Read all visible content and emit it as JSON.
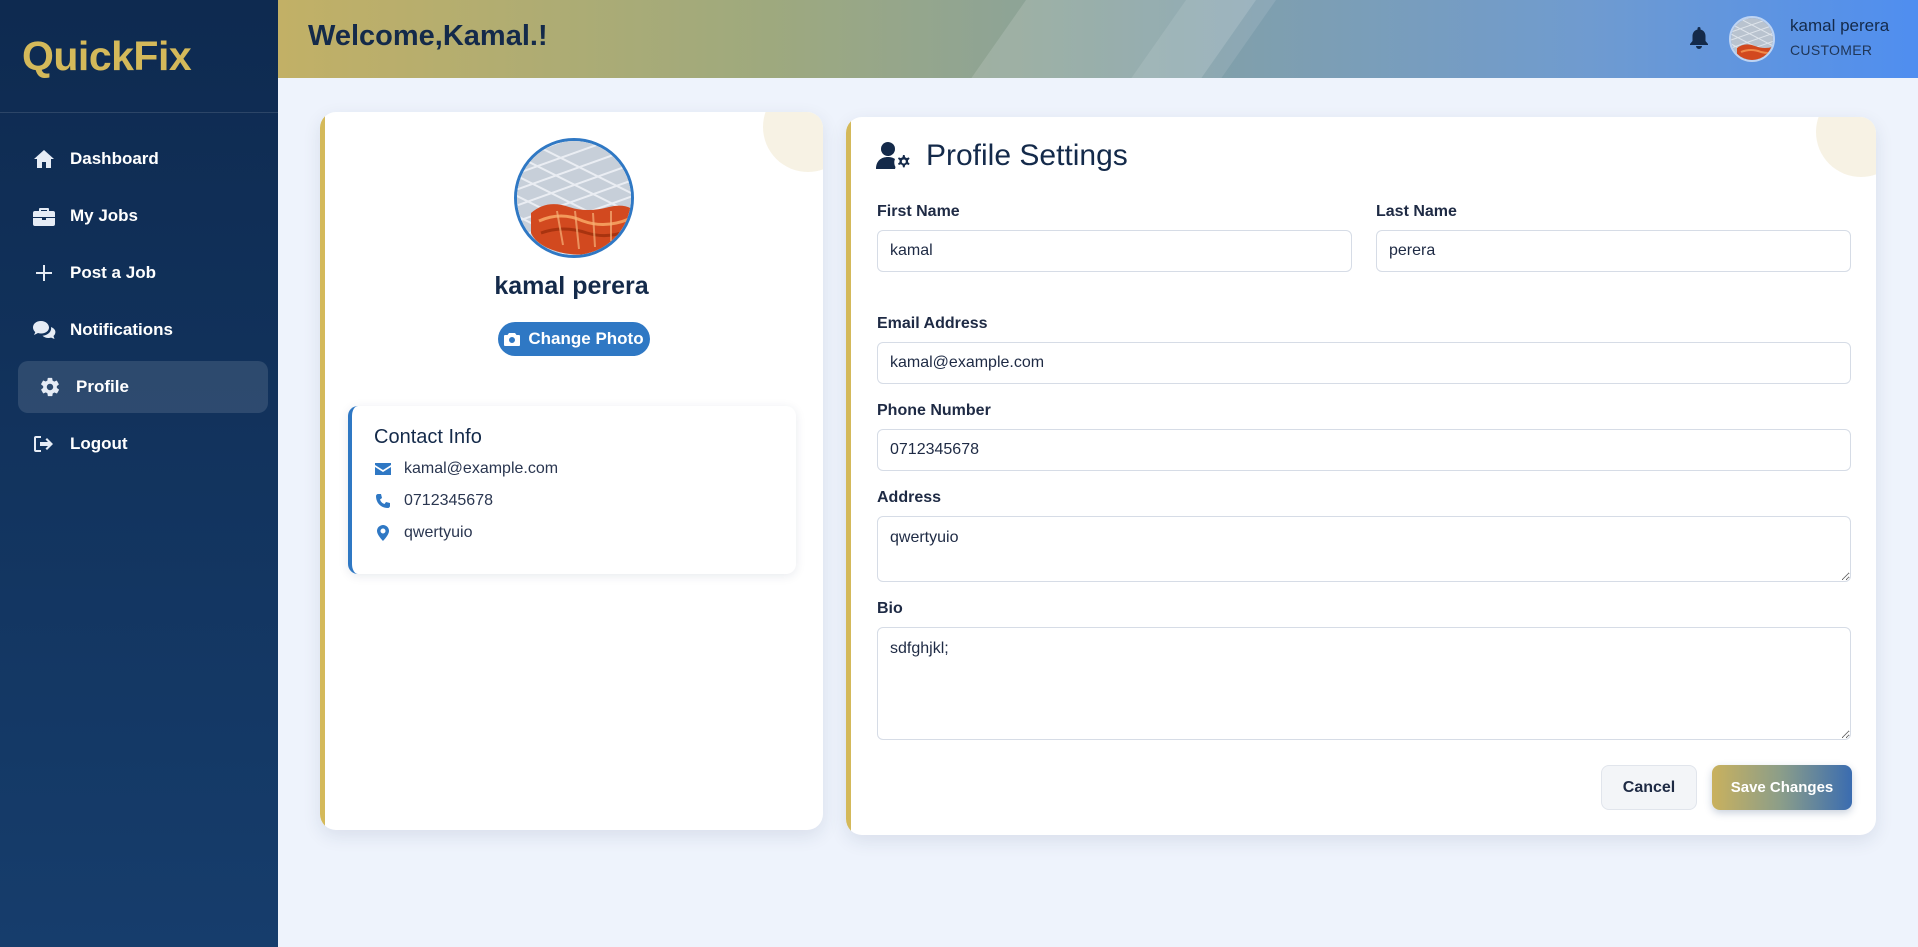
{
  "brand": {
    "name": "QuickFix",
    "color": "#d4b95a"
  },
  "sidebar": {
    "items": [
      {
        "label": "Dashboard",
        "icon": "home-icon"
      },
      {
        "label": "My Jobs",
        "icon": "briefcase-icon"
      },
      {
        "label": "Post a Job",
        "icon": "plus-icon"
      },
      {
        "label": "Notifications",
        "icon": "comments-icon"
      },
      {
        "label": "Profile",
        "icon": "gear-icon",
        "active": true
      },
      {
        "label": "Logout",
        "icon": "logout-icon"
      }
    ]
  },
  "header": {
    "welcome": "Welcome,Kamal.!",
    "user_name": "kamal perera",
    "user_role": "CUSTOMER"
  },
  "profile_card": {
    "name": "kamal perera",
    "change_photo_label": "Change Photo",
    "contact": {
      "title": "Contact Info",
      "email": "kamal@example.com",
      "phone": "0712345678",
      "address": "qwertyuio"
    }
  },
  "form": {
    "title": "Profile Settings",
    "first_name": {
      "label": "First Name",
      "value": "kamal"
    },
    "last_name": {
      "label": "Last Name",
      "value": "perera"
    },
    "email": {
      "label": "Email Address",
      "value": "kamal@example.com"
    },
    "phone": {
      "label": "Phone Number",
      "value": "0712345678"
    },
    "address": {
      "label": "Address",
      "value": "qwertyuio"
    },
    "bio": {
      "label": "Bio",
      "value": "sdfghjkl;"
    },
    "cancel_label": "Cancel",
    "save_label": "Save Changes"
  },
  "colors": {
    "accent_blue": "#2f78c4",
    "sidebar_bg": "#0e2a50",
    "gold": "#d4b95a"
  }
}
